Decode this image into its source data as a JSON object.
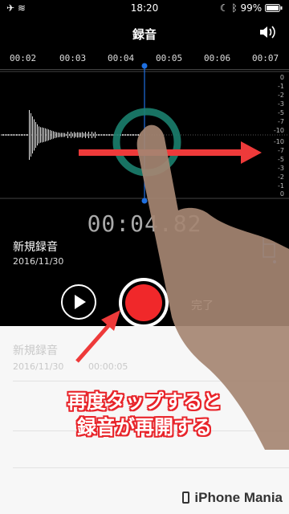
{
  "status_bar": {
    "time": "18:20",
    "battery": "99%"
  },
  "header": {
    "title": "録音"
  },
  "timeline": {
    "ticks": [
      "00:02",
      "00:03",
      "00:04",
      "00:05",
      "00:06",
      "00:07"
    ]
  },
  "db_scale": {
    "top": [
      "0",
      "-1",
      "-2",
      "-3",
      "-5",
      "-7",
      "-10"
    ],
    "bottom": [
      "-10",
      "-7",
      "-5",
      "-3",
      "-2",
      "-1",
      "0"
    ]
  },
  "playback": {
    "timecode": "00:04.82"
  },
  "recording": {
    "name": "新規録音",
    "date": "2016/11/30"
  },
  "controls": {
    "done_label": "完了"
  },
  "list": {
    "name": "新規録音",
    "date": "2016/11/30",
    "duration": "00:00:05"
  },
  "caption": {
    "line1": "再度タップすると",
    "line2": "録音が再開する"
  },
  "watermark": "iPhone Mania",
  "colors": {
    "accent": "#f0282a",
    "cursor": "#1e6fe0",
    "ring": "#1b7f6e",
    "arrow": "#ee3a3a"
  }
}
